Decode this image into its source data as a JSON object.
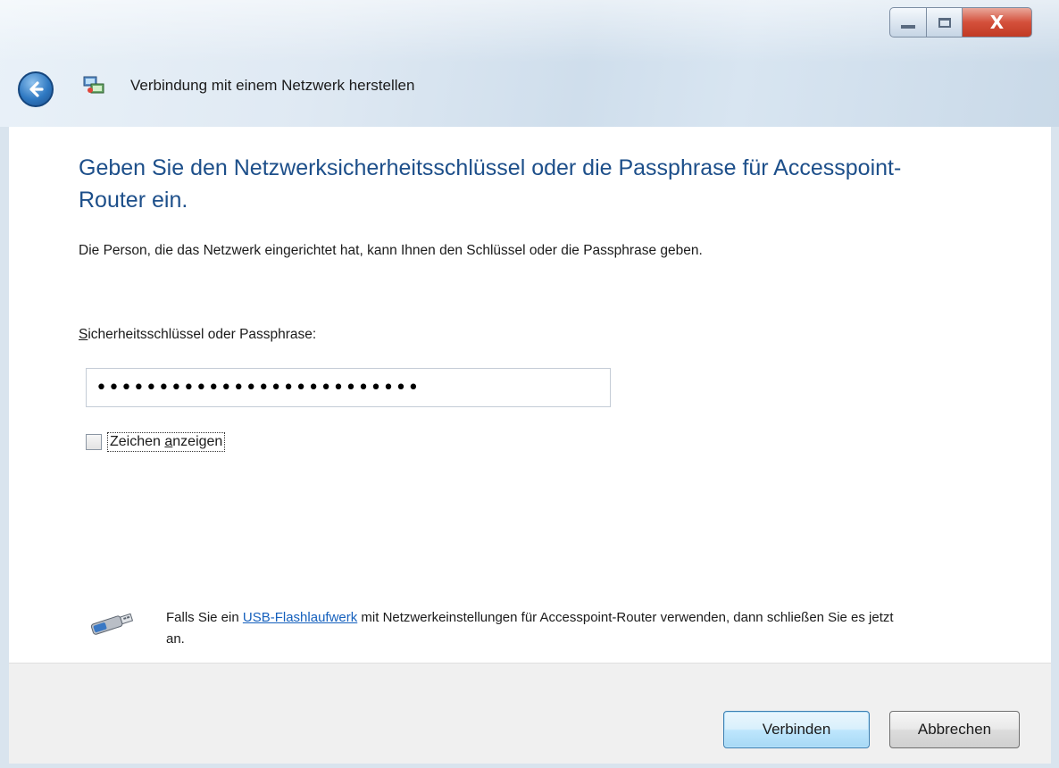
{
  "window": {
    "title": "Verbindung mit einem Netzwerk herstellen",
    "controls": {
      "minimize": "minimize",
      "maximize": "maximize",
      "close": "X"
    }
  },
  "main": {
    "heading": "Geben Sie den Netzwerksicherheitsschlüssel oder die Passphrase für Accesspoint-Router ein.",
    "description": "Die Person, die das Netzwerk eingerichtet hat, kann Ihnen den Schlüssel oder die Passphrase geben.",
    "password_label_first": "S",
    "password_label_rest": "icherheitsschlüssel oder Passphrase:",
    "password_value": "••••••••••••••••••••••••••",
    "show_chars_part1": "Zeichen ",
    "show_chars_part2_underlined": "a",
    "show_chars_part3": "nzeigen",
    "show_chars_checked": false,
    "usb_text_before": "Falls Sie ein ",
    "usb_link": "USB-Flashlaufwerk",
    "usb_text_after": " mit Netzwerkeinstellungen für Accesspoint-Router verwenden, dann schließen Sie es jetzt an."
  },
  "footer": {
    "connect_label": "Verbinden",
    "cancel_label": "Abbrechen"
  },
  "icons": {
    "back": "back-arrow-icon",
    "network": "network-icon",
    "usb": "usb-flash-drive-icon"
  }
}
